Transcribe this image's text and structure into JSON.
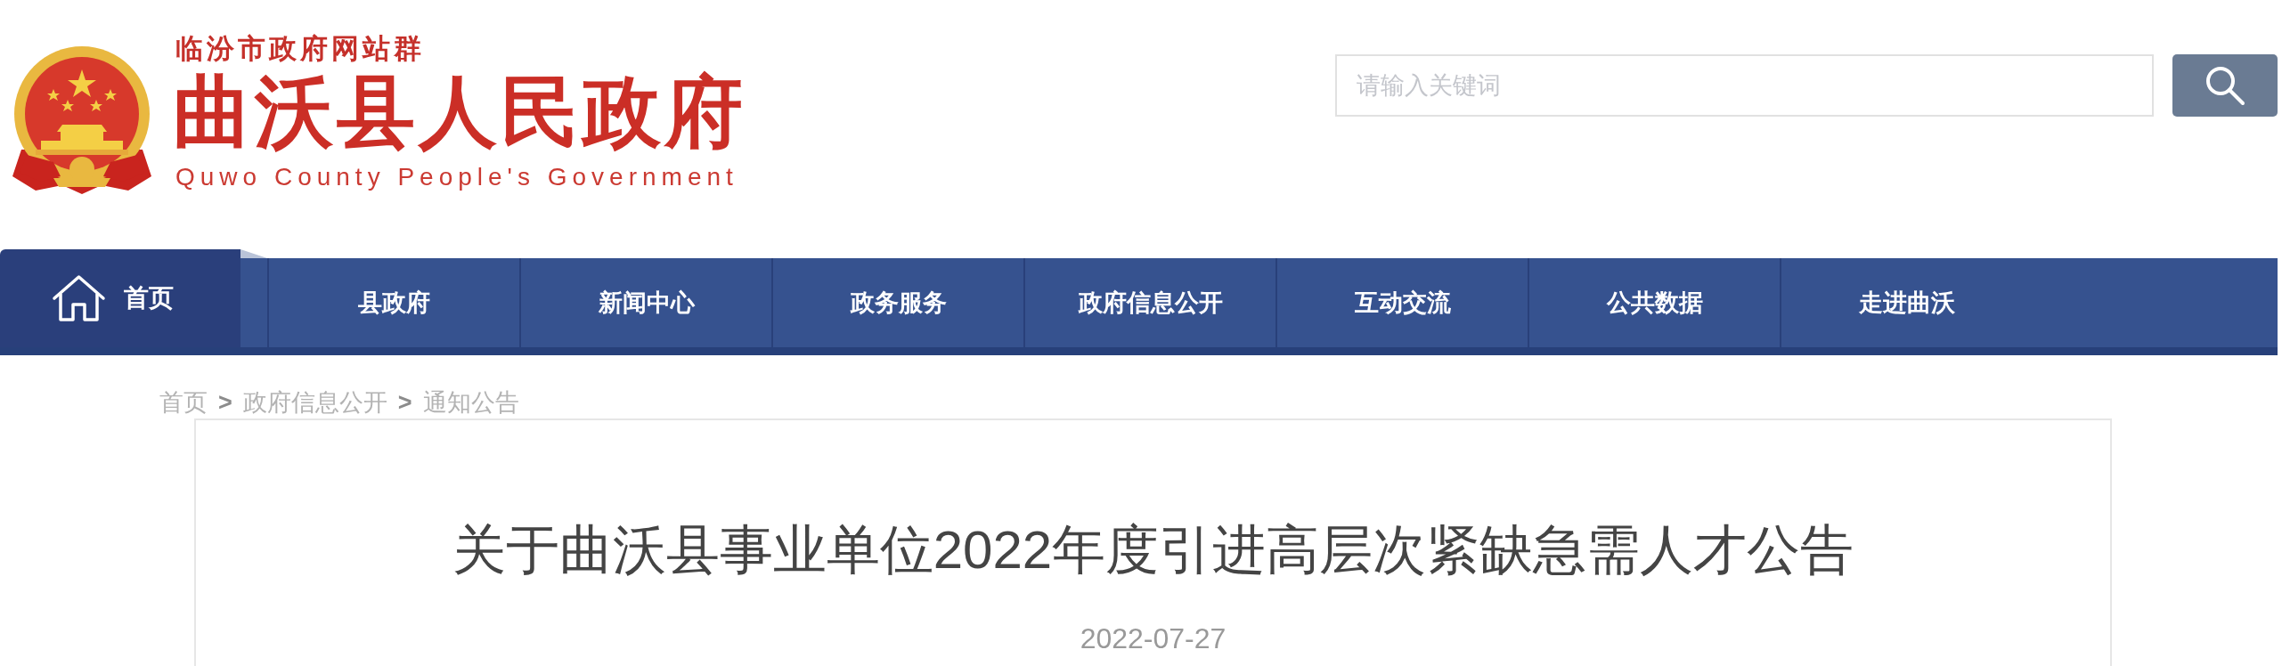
{
  "header": {
    "site_group": "临汾市政府网站群",
    "site_title": "曲沃县人民政府",
    "site_title_en": "Quwo County People's Government"
  },
  "search": {
    "placeholder": "请输入关键词"
  },
  "nav": [
    {
      "label": "首页",
      "kind": "home",
      "selected": true
    },
    {
      "label": "县政府",
      "kind": "link",
      "selected": false
    },
    {
      "label": "新闻中心",
      "kind": "link",
      "selected": false
    },
    {
      "label": "政务服务",
      "kind": "link",
      "selected": false
    },
    {
      "label": "政府信息公开",
      "kind": "link",
      "selected": false
    },
    {
      "label": "互动交流",
      "kind": "link",
      "selected": false
    },
    {
      "label": "公共数据",
      "kind": "link",
      "selected": false
    },
    {
      "label": "走进曲沃",
      "kind": "link",
      "selected": false
    }
  ],
  "breadcrumb": [
    {
      "kind": "link",
      "label": "首页"
    },
    {
      "kind": "separator",
      "label": ">"
    },
    {
      "kind": "link",
      "label": "政府信息公开"
    },
    {
      "kind": "separator",
      "label": ">"
    },
    {
      "kind": "link",
      "label": "通知公告"
    }
  ],
  "article": {
    "title": "关于曲沃县事业单位2022年度引进高层次紧缺急需人才公告",
    "date": "2022-07-27"
  }
}
